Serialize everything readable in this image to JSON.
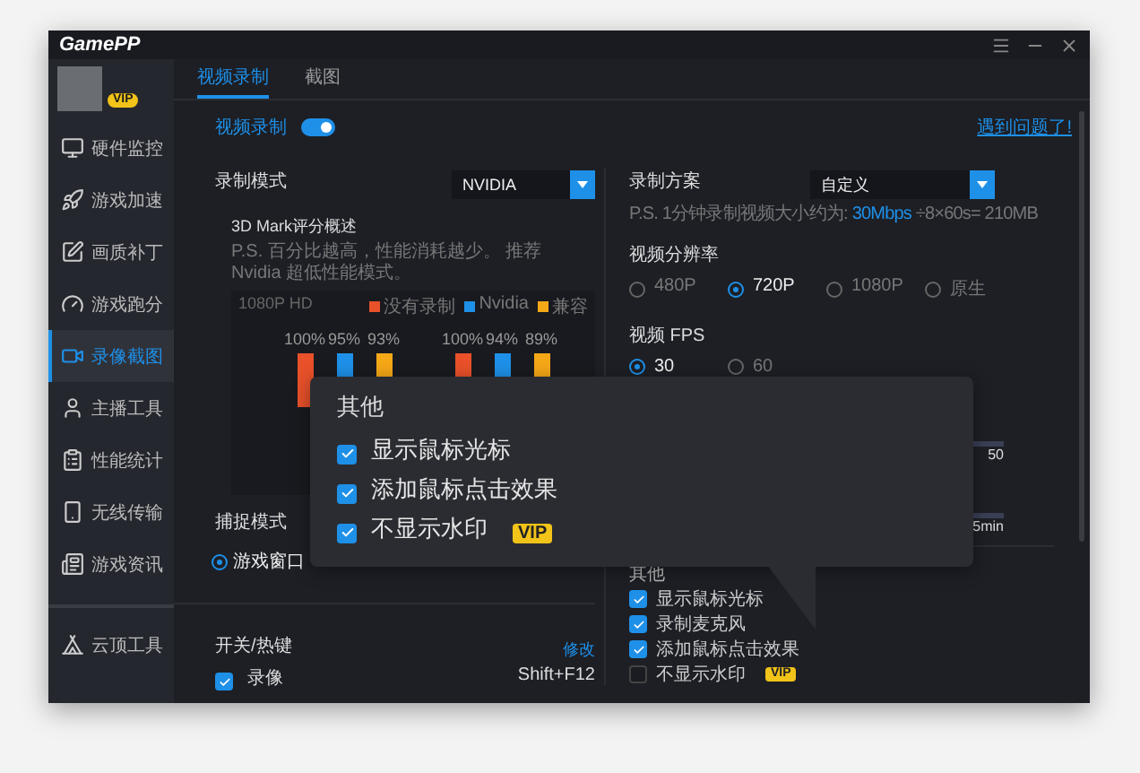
{
  "window": {
    "logo": "GamePP"
  },
  "profile": {
    "badge": "VIP"
  },
  "sidebar": {
    "items": [
      {
        "label": "硬件监控",
        "selected": false
      },
      {
        "label": "游戏加速",
        "selected": false
      },
      {
        "label": "画质补丁",
        "selected": false
      },
      {
        "label": "游戏跑分",
        "selected": false
      },
      {
        "label": "录像截图",
        "selected": true
      },
      {
        "label": "主播工具",
        "selected": false
      },
      {
        "label": "性能统计",
        "selected": false
      },
      {
        "label": "无线传输",
        "selected": false
      },
      {
        "label": "游戏资讯",
        "selected": false
      }
    ],
    "footer_items": [
      {
        "label": "云顶工具",
        "selected": false
      }
    ]
  },
  "tabs": [
    {
      "label": "视频录制",
      "selected": true
    },
    {
      "label": "截图",
      "selected": false
    }
  ],
  "recording_toggle": {
    "label": "视频录制",
    "on": true
  },
  "help_link": "遇到问题了!",
  "record_mode": {
    "label": "录制模式",
    "value": "NVIDIA"
  },
  "benchmark": {
    "title": "3D Mark评分概述",
    "note": "P.S. 百分比越高，性能消耗越少。 推荐 Nvidia 超低性能模式。",
    "resolution": "1080P HD",
    "legend": [
      {
        "name": "没有录制",
        "color": "#e8512a"
      },
      {
        "name": "Nvidia",
        "color": "#1e90e8"
      },
      {
        "name": "兼容",
        "color": "#f5a817"
      }
    ],
    "groups": [
      {
        "bars": [
          {
            "label": "100%"
          },
          {
            "label": "95%"
          },
          {
            "label": "93%"
          }
        ]
      },
      {
        "bars": [
          {
            "label": "100%"
          },
          {
            "label": "94%"
          },
          {
            "label": "89%"
          }
        ]
      }
    ]
  },
  "capture_mode": {
    "label": "捕捉模式",
    "options": [
      {
        "label": "游戏窗口",
        "selected": true
      }
    ]
  },
  "hotkeys": {
    "label": "开关/热键",
    "edit_link": "修改",
    "items": [
      {
        "label": "录像",
        "checked": true,
        "key": "Shift+F12"
      }
    ]
  },
  "record_plan": {
    "label": "录制方案",
    "value": "自定义",
    "note_prefix": "P.S. 1分钟录制视频大小约为: ",
    "bitrate": "30Mbps",
    "note_suffix": " ÷8×60s= 210MB"
  },
  "resolution": {
    "label": "视频分辨率",
    "options": [
      {
        "label": "480P",
        "selected": false
      },
      {
        "label": "720P",
        "selected": true
      },
      {
        "label": "1080P",
        "selected": false
      },
      {
        "label": "原生",
        "selected": false
      }
    ]
  },
  "fps": {
    "label": "视频 FPS",
    "options": [
      {
        "label": "30",
        "selected": true
      },
      {
        "label": "60",
        "selected": false
      }
    ]
  },
  "sliders": [
    {
      "reading": "50"
    },
    {
      "reading": "5min"
    }
  ],
  "other": {
    "label": "其他",
    "items": [
      {
        "label": "显示鼠标光标",
        "checked": true,
        "vip": false
      },
      {
        "label": "录制麦克风",
        "checked": true,
        "vip": false
      },
      {
        "label": "添加鼠标点击效果",
        "checked": true,
        "vip": false
      },
      {
        "label": "不显示水印",
        "checked": false,
        "vip": true
      }
    ],
    "vip_badge": "VIP"
  },
  "popover": {
    "title": "其他",
    "items": [
      {
        "label": "显示鼠标光标",
        "checked": true,
        "vip": false
      },
      {
        "label": "添加鼠标点击效果",
        "checked": true,
        "vip": false
      },
      {
        "label": "不显示水印",
        "checked": true,
        "vip": true
      }
    ],
    "vip_badge": "VIP"
  }
}
